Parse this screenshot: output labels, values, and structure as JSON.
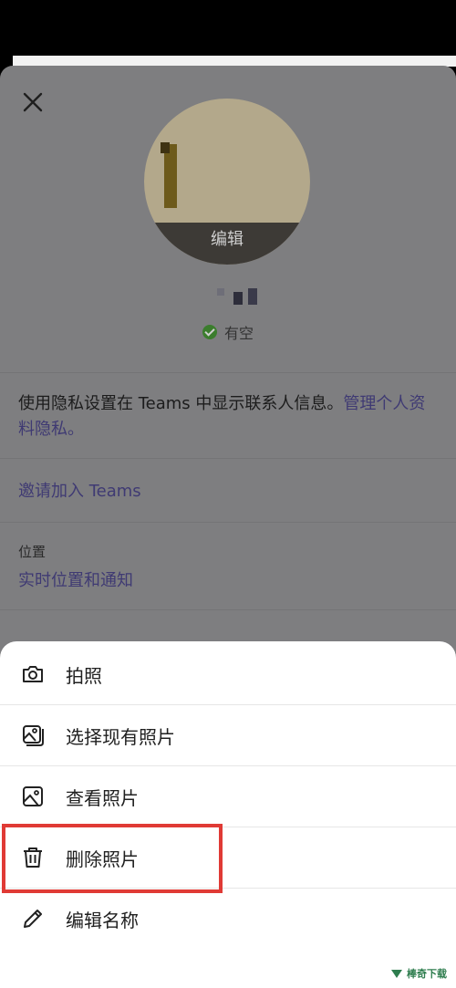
{
  "profile": {
    "avatar_edit_label": "编辑",
    "status_text": "有空",
    "privacy_text": "使用隐私设置在 Teams 中显示联系人信息。",
    "privacy_link": "管理个人资料隐私。",
    "invite_link": "邀请加入 Teams",
    "location_label": "位置",
    "location_link": "实时位置和通知"
  },
  "sheet": {
    "items": [
      {
        "label": "拍照",
        "icon": "camera-icon"
      },
      {
        "label": "选择现有照片",
        "icon": "photo-gallery-icon"
      },
      {
        "label": "查看照片",
        "icon": "image-icon"
      },
      {
        "label": "删除照片",
        "icon": "trash-icon"
      },
      {
        "label": "编辑名称",
        "icon": "pencil-icon"
      }
    ]
  },
  "watermark": "棒奇下载",
  "colors": {
    "accent_link": "#3f3a73",
    "status_available": "#3b7d2d",
    "highlight_border": "#e03a35"
  }
}
